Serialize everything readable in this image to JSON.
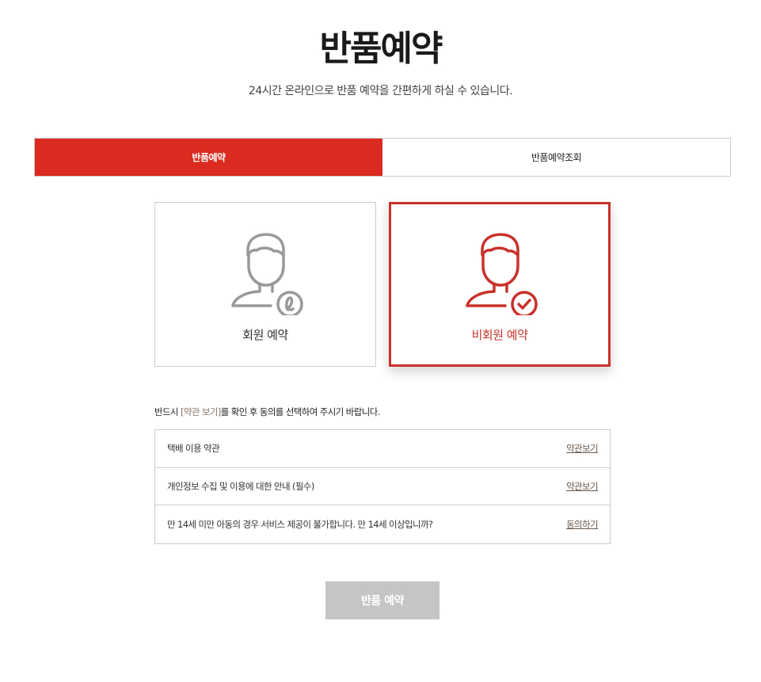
{
  "page": {
    "title": "반품예약",
    "subtitle": "24시간 온라인으로 반품 예약을 간편하게 하실 수 있습니다."
  },
  "tabs": [
    {
      "label": "반품예약",
      "active": true
    },
    {
      "label": "반품예약조회",
      "active": false
    }
  ],
  "cards": {
    "member": {
      "label": "회원 예약",
      "icon": "user-login-icon",
      "color": "#999999"
    },
    "guest": {
      "label": "비회원 예약",
      "icon": "user-check-icon",
      "color": "#c8322a",
      "selected": true
    }
  },
  "notice": {
    "prefix": "반드시 ",
    "highlight": "[약관 보기]",
    "suffix": "를 확인 후 동의를 선택하여 주시기 바랍니다."
  },
  "terms": [
    {
      "text": "택배 이용 약관",
      "link": "약관보기"
    },
    {
      "text": "개인정보 수집 및 이용에 대한 안내 (필수)",
      "link": "약관보기"
    },
    {
      "text": "만 14세 미만 아동의 경우 서비스 제공이 불가합니다. 만 14세 이상입니까?",
      "link": "동의하기"
    }
  ],
  "submit": {
    "label": "반품 예약"
  },
  "colors": {
    "accent": "#db2a1f",
    "guest_border": "#c8322a",
    "disabled_button": "#c4c5c7",
    "link": "#6b5a4d"
  }
}
